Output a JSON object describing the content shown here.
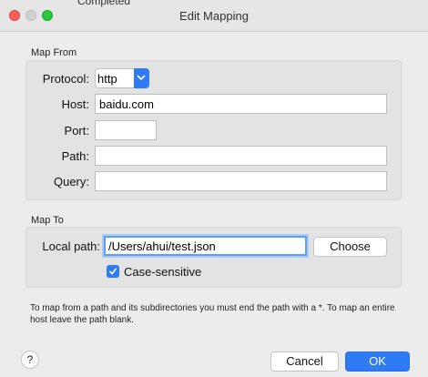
{
  "window": {
    "title": "Edit Mapping",
    "behind_text": "Completed"
  },
  "map_from": {
    "heading": "Map From",
    "protocol": {
      "label": "Protocol:",
      "value": "http"
    },
    "host": {
      "label": "Host:",
      "value": "baidu.com"
    },
    "port": {
      "label": "Port:",
      "value": ""
    },
    "path": {
      "label": "Path:",
      "value": ""
    },
    "query": {
      "label": "Query:",
      "value": ""
    }
  },
  "map_to": {
    "heading": "Map To",
    "local_path": {
      "label": "Local path:",
      "value": "/Users/ahui/test.json"
    },
    "choose_label": "Choose",
    "case_sensitive": {
      "label": "Case-sensitive",
      "checked": true
    }
  },
  "note": "To map from a path and its subdirectories you must end the path with a *. To map an entire host leave the path blank.",
  "footer": {
    "help_label": "?",
    "cancel_label": "Cancel",
    "ok_label": "OK"
  },
  "colors": {
    "accent": "#2f7bf5",
    "close": "#ff5f57",
    "maximize": "#28c840"
  },
  "icons": [
    "close-window-icon",
    "minimize-window-icon",
    "maximize-window-icon",
    "chevron-down-icon",
    "checkmark-icon"
  ]
}
